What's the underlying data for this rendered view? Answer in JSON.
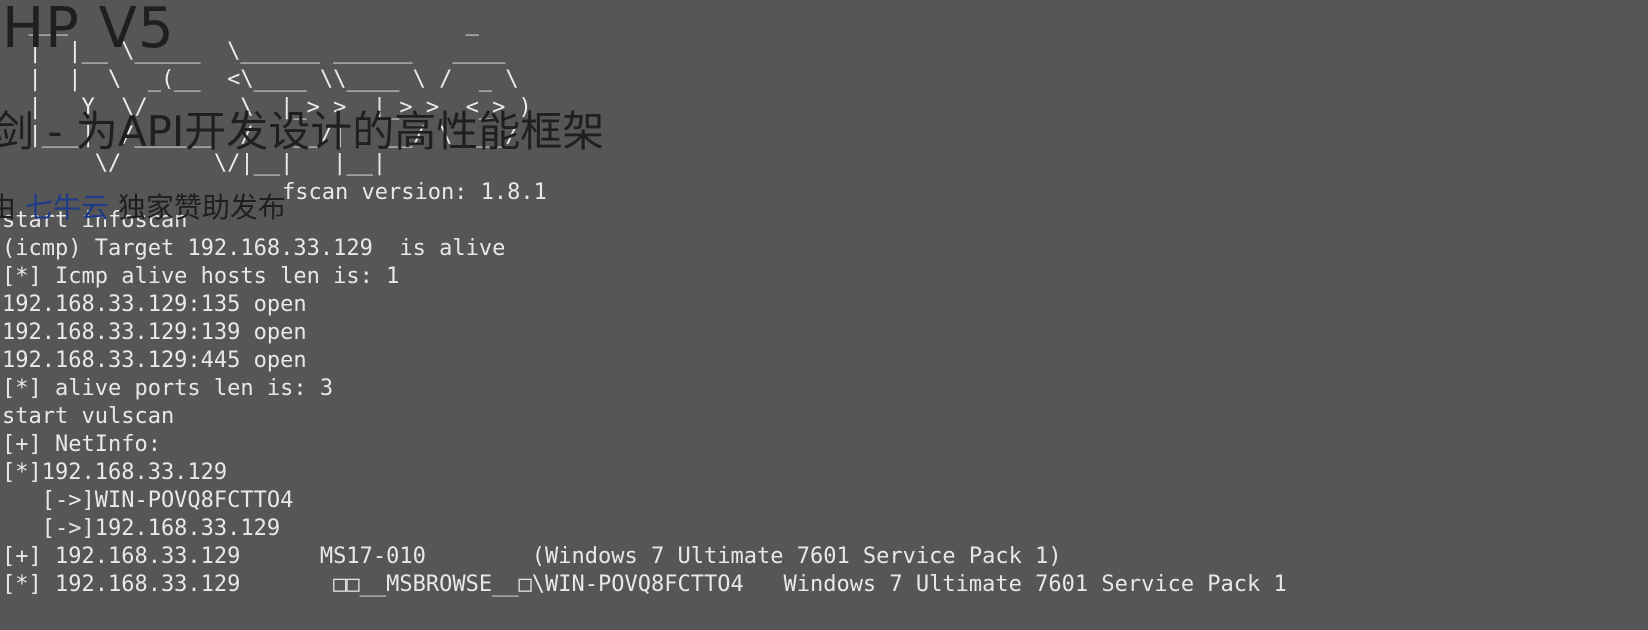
{
  "overlay": {
    "title": "HP V5",
    "subtitle": "剑 - 为API开发设计的高性能框架",
    "sponsor_prefix": "由 ",
    "sponsor_link": "七牛云",
    "sponsor_suffix": " 独家赞助发布"
  },
  "terminal": {
    "ascii": [
      "  ___                              _",
      "  |  |__ \\_____  \\______ ______   ____",
      "  |  |  \\  _(__  <\\____ \\\\____ \\ /  _ \\",
      "  |   Y  \\/       \\  |_> >  |_> >  <_> )",
      "  |___|  /______  /   __/|   __/ \\____/",
      "       \\/       \\/|__|   |__|"
    ],
    "version": "fscan version: 1.8.1",
    "lines": [
      "start infoscan",
      "(icmp) Target 192.168.33.129  is alive",
      "[*] Icmp alive hosts len is: 1",
      "192.168.33.129:135 open",
      "192.168.33.129:139 open",
      "192.168.33.129:445 open",
      "[*] alive ports len is: 3",
      "start vulscan",
      "[+] NetInfo:",
      "[*]192.168.33.129",
      "   [->]WIN-POVQ8FCTTO4",
      "   [->]192.168.33.129",
      "[+] 192.168.33.129      MS17-010        (Windows 7 Ultimate 7601 Service Pack 1)",
      "[*] 192.168.33.129       □□__MSBROWSE__□\\WIN-POVQ8FCTTO4   Windows 7 Ultimate 7601 Service Pack 1"
    ]
  }
}
